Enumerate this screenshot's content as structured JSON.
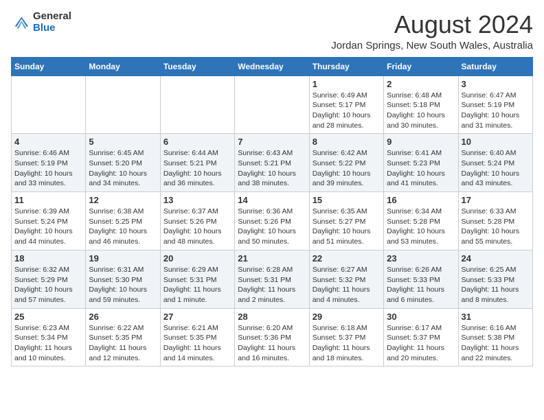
{
  "logo": {
    "general": "General",
    "blue": "Blue"
  },
  "title": "August 2024",
  "subtitle": "Jordan Springs, New South Wales, Australia",
  "days_of_week": [
    "Sunday",
    "Monday",
    "Tuesday",
    "Wednesday",
    "Thursday",
    "Friday",
    "Saturday"
  ],
  "weeks": [
    [
      {
        "day": "",
        "info": ""
      },
      {
        "day": "",
        "info": ""
      },
      {
        "day": "",
        "info": ""
      },
      {
        "day": "",
        "info": ""
      },
      {
        "day": "1",
        "info": "Sunrise: 6:49 AM\nSunset: 5:17 PM\nDaylight: 10 hours\nand 28 minutes."
      },
      {
        "day": "2",
        "info": "Sunrise: 6:48 AM\nSunset: 5:18 PM\nDaylight: 10 hours\nand 30 minutes."
      },
      {
        "day": "3",
        "info": "Sunrise: 6:47 AM\nSunset: 5:19 PM\nDaylight: 10 hours\nand 31 minutes."
      }
    ],
    [
      {
        "day": "4",
        "info": "Sunrise: 6:46 AM\nSunset: 5:19 PM\nDaylight: 10 hours\nand 33 minutes."
      },
      {
        "day": "5",
        "info": "Sunrise: 6:45 AM\nSunset: 5:20 PM\nDaylight: 10 hours\nand 34 minutes."
      },
      {
        "day": "6",
        "info": "Sunrise: 6:44 AM\nSunset: 5:21 PM\nDaylight: 10 hours\nand 36 minutes."
      },
      {
        "day": "7",
        "info": "Sunrise: 6:43 AM\nSunset: 5:21 PM\nDaylight: 10 hours\nand 38 minutes."
      },
      {
        "day": "8",
        "info": "Sunrise: 6:42 AM\nSunset: 5:22 PM\nDaylight: 10 hours\nand 39 minutes."
      },
      {
        "day": "9",
        "info": "Sunrise: 6:41 AM\nSunset: 5:23 PM\nDaylight: 10 hours\nand 41 minutes."
      },
      {
        "day": "10",
        "info": "Sunrise: 6:40 AM\nSunset: 5:24 PM\nDaylight: 10 hours\nand 43 minutes."
      }
    ],
    [
      {
        "day": "11",
        "info": "Sunrise: 6:39 AM\nSunset: 5:24 PM\nDaylight: 10 hours\nand 44 minutes."
      },
      {
        "day": "12",
        "info": "Sunrise: 6:38 AM\nSunset: 5:25 PM\nDaylight: 10 hours\nand 46 minutes."
      },
      {
        "day": "13",
        "info": "Sunrise: 6:37 AM\nSunset: 5:26 PM\nDaylight: 10 hours\nand 48 minutes."
      },
      {
        "day": "14",
        "info": "Sunrise: 6:36 AM\nSunset: 5:26 PM\nDaylight: 10 hours\nand 50 minutes."
      },
      {
        "day": "15",
        "info": "Sunrise: 6:35 AM\nSunset: 5:27 PM\nDaylight: 10 hours\nand 51 minutes."
      },
      {
        "day": "16",
        "info": "Sunrise: 6:34 AM\nSunset: 5:28 PM\nDaylight: 10 hours\nand 53 minutes."
      },
      {
        "day": "17",
        "info": "Sunrise: 6:33 AM\nSunset: 5:28 PM\nDaylight: 10 hours\nand 55 minutes."
      }
    ],
    [
      {
        "day": "18",
        "info": "Sunrise: 6:32 AM\nSunset: 5:29 PM\nDaylight: 10 hours\nand 57 minutes."
      },
      {
        "day": "19",
        "info": "Sunrise: 6:31 AM\nSunset: 5:30 PM\nDaylight: 10 hours\nand 59 minutes."
      },
      {
        "day": "20",
        "info": "Sunrise: 6:29 AM\nSunset: 5:31 PM\nDaylight: 11 hours\nand 1 minute."
      },
      {
        "day": "21",
        "info": "Sunrise: 6:28 AM\nSunset: 5:31 PM\nDaylight: 11 hours\nand 2 minutes."
      },
      {
        "day": "22",
        "info": "Sunrise: 6:27 AM\nSunset: 5:32 PM\nDaylight: 11 hours\nand 4 minutes."
      },
      {
        "day": "23",
        "info": "Sunrise: 6:26 AM\nSunset: 5:33 PM\nDaylight: 11 hours\nand 6 minutes."
      },
      {
        "day": "24",
        "info": "Sunrise: 6:25 AM\nSunset: 5:33 PM\nDaylight: 11 hours\nand 8 minutes."
      }
    ],
    [
      {
        "day": "25",
        "info": "Sunrise: 6:23 AM\nSunset: 5:34 PM\nDaylight: 11 hours\nand 10 minutes."
      },
      {
        "day": "26",
        "info": "Sunrise: 6:22 AM\nSunset: 5:35 PM\nDaylight: 11 hours\nand 12 minutes."
      },
      {
        "day": "27",
        "info": "Sunrise: 6:21 AM\nSunset: 5:35 PM\nDaylight: 11 hours\nand 14 minutes."
      },
      {
        "day": "28",
        "info": "Sunrise: 6:20 AM\nSunset: 5:36 PM\nDaylight: 11 hours\nand 16 minutes."
      },
      {
        "day": "29",
        "info": "Sunrise: 6:18 AM\nSunset: 5:37 PM\nDaylight: 11 hours\nand 18 minutes."
      },
      {
        "day": "30",
        "info": "Sunrise: 6:17 AM\nSunset: 5:37 PM\nDaylight: 11 hours\nand 20 minutes."
      },
      {
        "day": "31",
        "info": "Sunrise: 6:16 AM\nSunset: 5:38 PM\nDaylight: 11 hours\nand 22 minutes."
      }
    ]
  ]
}
